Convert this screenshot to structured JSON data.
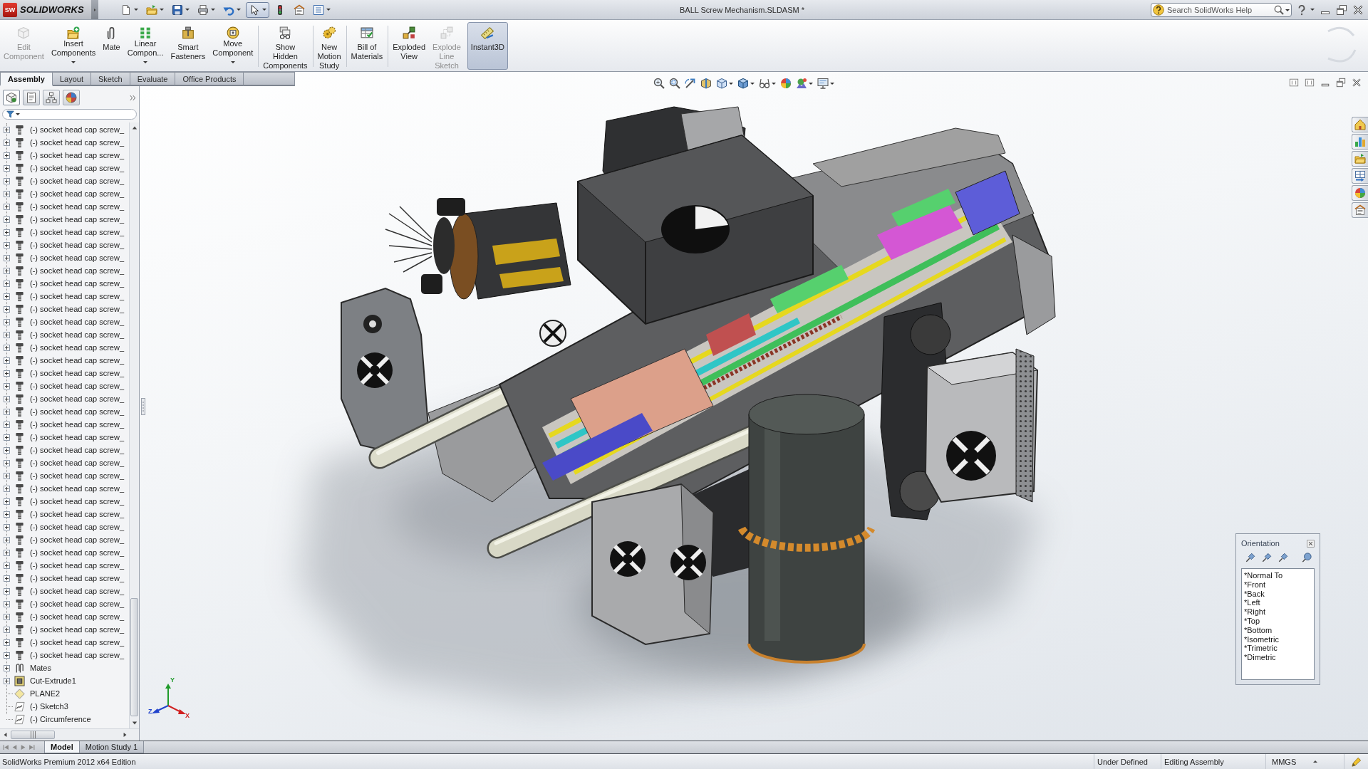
{
  "title_bar": {
    "logo_mark": "SW",
    "logo": "SOLIDWORKS",
    "quick_access": [
      {
        "kind": "new",
        "dropdown": true,
        "selected": false
      },
      {
        "kind": "open",
        "dropdown": true,
        "selected": false
      },
      {
        "kind": "save",
        "dropdown": true,
        "selected": false
      },
      {
        "kind": "print",
        "dropdown": true,
        "selected": false
      },
      {
        "kind": "undo",
        "dropdown": true,
        "selected": false
      },
      {
        "kind": "select",
        "dropdown": true,
        "selected": true
      },
      {
        "kind": "rebuild",
        "dropdown": false,
        "selected": false
      },
      {
        "kind": "options",
        "dropdown": false,
        "selected": false
      },
      {
        "kind": "properties",
        "dropdown": true,
        "selected": false
      }
    ],
    "title": "BALL Screw Mechanism.SLDASM *",
    "search": {
      "placeholder": "Search SolidWorks Help"
    }
  },
  "command_manager": {
    "commands": [
      {
        "kind": "edit",
        "label": "Edit Component",
        "disabled": true,
        "dropdown": false,
        "selected": false,
        "separator": false
      },
      {
        "kind": "insert",
        "label": "Insert Components",
        "disabled": false,
        "dropdown": true,
        "selected": false,
        "separator": false
      },
      {
        "kind": "mate",
        "label": "Mate",
        "disabled": false,
        "dropdown": false,
        "selected": false,
        "separator": false
      },
      {
        "kind": "pattern",
        "label": "Linear Compon...",
        "disabled": false,
        "dropdown": true,
        "selected": false,
        "separator": false
      },
      {
        "kind": "fastener",
        "label": "Smart Fasteners",
        "disabled": false,
        "dropdown": false,
        "selected": false,
        "separator": false
      },
      {
        "kind": "move",
        "label": "Move Component",
        "disabled": false,
        "dropdown": true,
        "selected": false,
        "separator": false
      },
      {
        "kind": "show",
        "label": "Show Hidden Components",
        "disabled": false,
        "dropdown": false,
        "selected": false,
        "separator": true
      },
      {
        "kind": "motion",
        "label": "New Motion Study",
        "disabled": false,
        "dropdown": false,
        "selected": false,
        "separator": true
      },
      {
        "kind": "bom",
        "label": "Bill of Materials",
        "disabled": false,
        "dropdown": false,
        "selected": false,
        "separator": true
      },
      {
        "kind": "explode",
        "label": "Exploded View",
        "disabled": false,
        "dropdown": false,
        "selected": false,
        "separator": true
      },
      {
        "kind": "explode_line",
        "label": "Explode Line Sketch",
        "disabled": true,
        "dropdown": false,
        "selected": false,
        "separator": false
      },
      {
        "kind": "instant3d",
        "label": "Instant3D",
        "disabled": false,
        "dropdown": false,
        "selected": true,
        "separator": false
      }
    ],
    "tabs": [
      {
        "label": "Assembly",
        "selected": true
      },
      {
        "label": "Layout",
        "selected": false
      },
      {
        "label": "Sketch",
        "selected": false
      },
      {
        "label": "Evaluate",
        "selected": false
      },
      {
        "label": "Office Products",
        "selected": false
      }
    ]
  },
  "feature_manager": {
    "panel_tabs": [
      {
        "kind": "features",
        "selected": true
      },
      {
        "kind": "properties",
        "selected": false
      },
      {
        "kind": "configurations",
        "selected": false
      },
      {
        "kind": "display",
        "selected": false
      }
    ],
    "tree": [
      {
        "kind": "part",
        "label": "(-) socket head cap screw_",
        "expandable": true,
        "expanded": false
      },
      {
        "kind": "part",
        "label": "(-) socket head cap screw_",
        "expandable": true,
        "expanded": false
      },
      {
        "kind": "part",
        "label": "(-) socket head cap screw_",
        "expandable": true,
        "expanded": false
      },
      {
        "kind": "part",
        "label": "(-) socket head cap screw_",
        "expandable": true,
        "expanded": false
      },
      {
        "kind": "part",
        "label": "(-) socket head cap screw_",
        "expandable": true,
        "expanded": false
      },
      {
        "kind": "part",
        "label": "(-) socket head cap screw_",
        "expandable": true,
        "expanded": false
      },
      {
        "kind": "part",
        "label": "(-) socket head cap screw_",
        "expandable": true,
        "expanded": false
      },
      {
        "kind": "part",
        "label": "(-) socket head cap screw_",
        "expandable": true,
        "expanded": false
      },
      {
        "kind": "part",
        "label": "(-) socket head cap screw_",
        "expandable": true,
        "expanded": false
      },
      {
        "kind": "part",
        "label": "(-) socket head cap screw_",
        "expandable": true,
        "expanded": false
      },
      {
        "kind": "part",
        "label": "(-) socket head cap screw_",
        "expandable": true,
        "expanded": false
      },
      {
        "kind": "part",
        "label": "(-) socket head cap screw_",
        "expandable": true,
        "expanded": false
      },
      {
        "kind": "part",
        "label": "(-) socket head cap screw_",
        "expandable": true,
        "expanded": false
      },
      {
        "kind": "part",
        "label": "(-) socket head cap screw_",
        "expandable": true,
        "expanded": false
      },
      {
        "kind": "part",
        "label": "(-) socket head cap screw_",
        "expandable": true,
        "expanded": false
      },
      {
        "kind": "part",
        "label": "(-) socket head cap screw_",
        "expandable": true,
        "expanded": false
      },
      {
        "kind": "part",
        "label": "(-) socket head cap screw_",
        "expandable": true,
        "expanded": false
      },
      {
        "kind": "part",
        "label": "(-) socket head cap screw_",
        "expandable": true,
        "expanded": false
      },
      {
        "kind": "part",
        "label": "(-) socket head cap screw_",
        "expandable": true,
        "expanded": false
      },
      {
        "kind": "part",
        "label": "(-) socket head cap screw_",
        "expandable": true,
        "expanded": false
      },
      {
        "kind": "part",
        "label": "(-) socket head cap screw_",
        "expandable": true,
        "expanded": false
      },
      {
        "kind": "part",
        "label": "(-) socket head cap screw_",
        "expandable": true,
        "expanded": false
      },
      {
        "kind": "part",
        "label": "(-) socket head cap screw_",
        "expandable": true,
        "expanded": false
      },
      {
        "kind": "part",
        "label": "(-) socket head cap screw_",
        "expandable": true,
        "expanded": false
      },
      {
        "kind": "part",
        "label": "(-) socket head cap screw_",
        "expandable": true,
        "expanded": false
      },
      {
        "kind": "part",
        "label": "(-) socket head cap screw_",
        "expandable": true,
        "expanded": false
      },
      {
        "kind": "part",
        "label": "(-) socket head cap screw_",
        "expandable": true,
        "expanded": false
      },
      {
        "kind": "part",
        "label": "(-) socket head cap screw_",
        "expandable": true,
        "expanded": false
      },
      {
        "kind": "part",
        "label": "(-) socket head cap screw_",
        "expandable": true,
        "expanded": false
      },
      {
        "kind": "part",
        "label": "(-) socket head cap screw_",
        "expandable": true,
        "expanded": false
      },
      {
        "kind": "part",
        "label": "(-) socket head cap screw_",
        "expandable": true,
        "expanded": false
      },
      {
        "kind": "part",
        "label": "(-) socket head cap screw_",
        "expandable": true,
        "expanded": false
      },
      {
        "kind": "part",
        "label": "(-) socket head cap screw_",
        "expandable": true,
        "expanded": false
      },
      {
        "kind": "part",
        "label": "(-) socket head cap screw_",
        "expandable": true,
        "expanded": false
      },
      {
        "kind": "part",
        "label": "(-) socket head cap screw_",
        "expandable": true,
        "expanded": false
      },
      {
        "kind": "part",
        "label": "(-) socket head cap screw_",
        "expandable": true,
        "expanded": false
      },
      {
        "kind": "part",
        "label": "(-) socket head cap screw_",
        "expandable": true,
        "expanded": false
      },
      {
        "kind": "part",
        "label": "(-) socket head cap screw_",
        "expandable": true,
        "expanded": false
      },
      {
        "kind": "part",
        "label": "(-) socket head cap screw_",
        "expandable": true,
        "expanded": false
      },
      {
        "kind": "part",
        "label": "(-) socket head cap screw_",
        "expandable": true,
        "expanded": false
      },
      {
        "kind": "part",
        "label": "(-) socket head cap screw_",
        "expandable": true,
        "expanded": false
      },
      {
        "kind": "part",
        "label": "(-) socket head cap screw_",
        "expandable": true,
        "expanded": false
      },
      {
        "kind": "mates",
        "label": "Mates",
        "expandable": true,
        "expanded": false
      },
      {
        "kind": "feature",
        "label": "Cut-Extrude1",
        "expandable": true,
        "expanded": false
      },
      {
        "kind": "plane",
        "label": "PLANE2",
        "expandable": false
      },
      {
        "kind": "sketch",
        "label": "(-) Sketch3",
        "expandable": false
      },
      {
        "kind": "sketch",
        "label": "(-) Circumference",
        "expandable": false
      }
    ]
  },
  "model_tabs": [
    {
      "label": "Model",
      "selected": true
    },
    {
      "label": "Motion Study 1",
      "selected": false
    }
  ],
  "graphics": {
    "triad_axes": [
      "Y",
      "Z",
      "X"
    ],
    "orientation": {
      "title": "Orientation",
      "views": [
        {
          "label": "*Normal To",
          "selected": false
        },
        {
          "label": "*Front",
          "selected": false
        },
        {
          "label": "*Back",
          "selected": false
        },
        {
          "label": "*Left",
          "selected": false
        },
        {
          "label": "*Right",
          "selected": false
        },
        {
          "label": "*Top",
          "selected": false
        },
        {
          "label": "*Bottom",
          "selected": false
        },
        {
          "label": "*Isometric",
          "selected": false
        },
        {
          "label": "*Trimetric",
          "selected": false
        },
        {
          "label": "*Dimetric",
          "selected": false
        }
      ]
    }
  },
  "status_bar": {
    "edition": "SolidWorks Premium 2012 x64 Edition",
    "fields": [
      "Under Defined",
      "Editing Assembly"
    ],
    "units": "MMGS"
  }
}
